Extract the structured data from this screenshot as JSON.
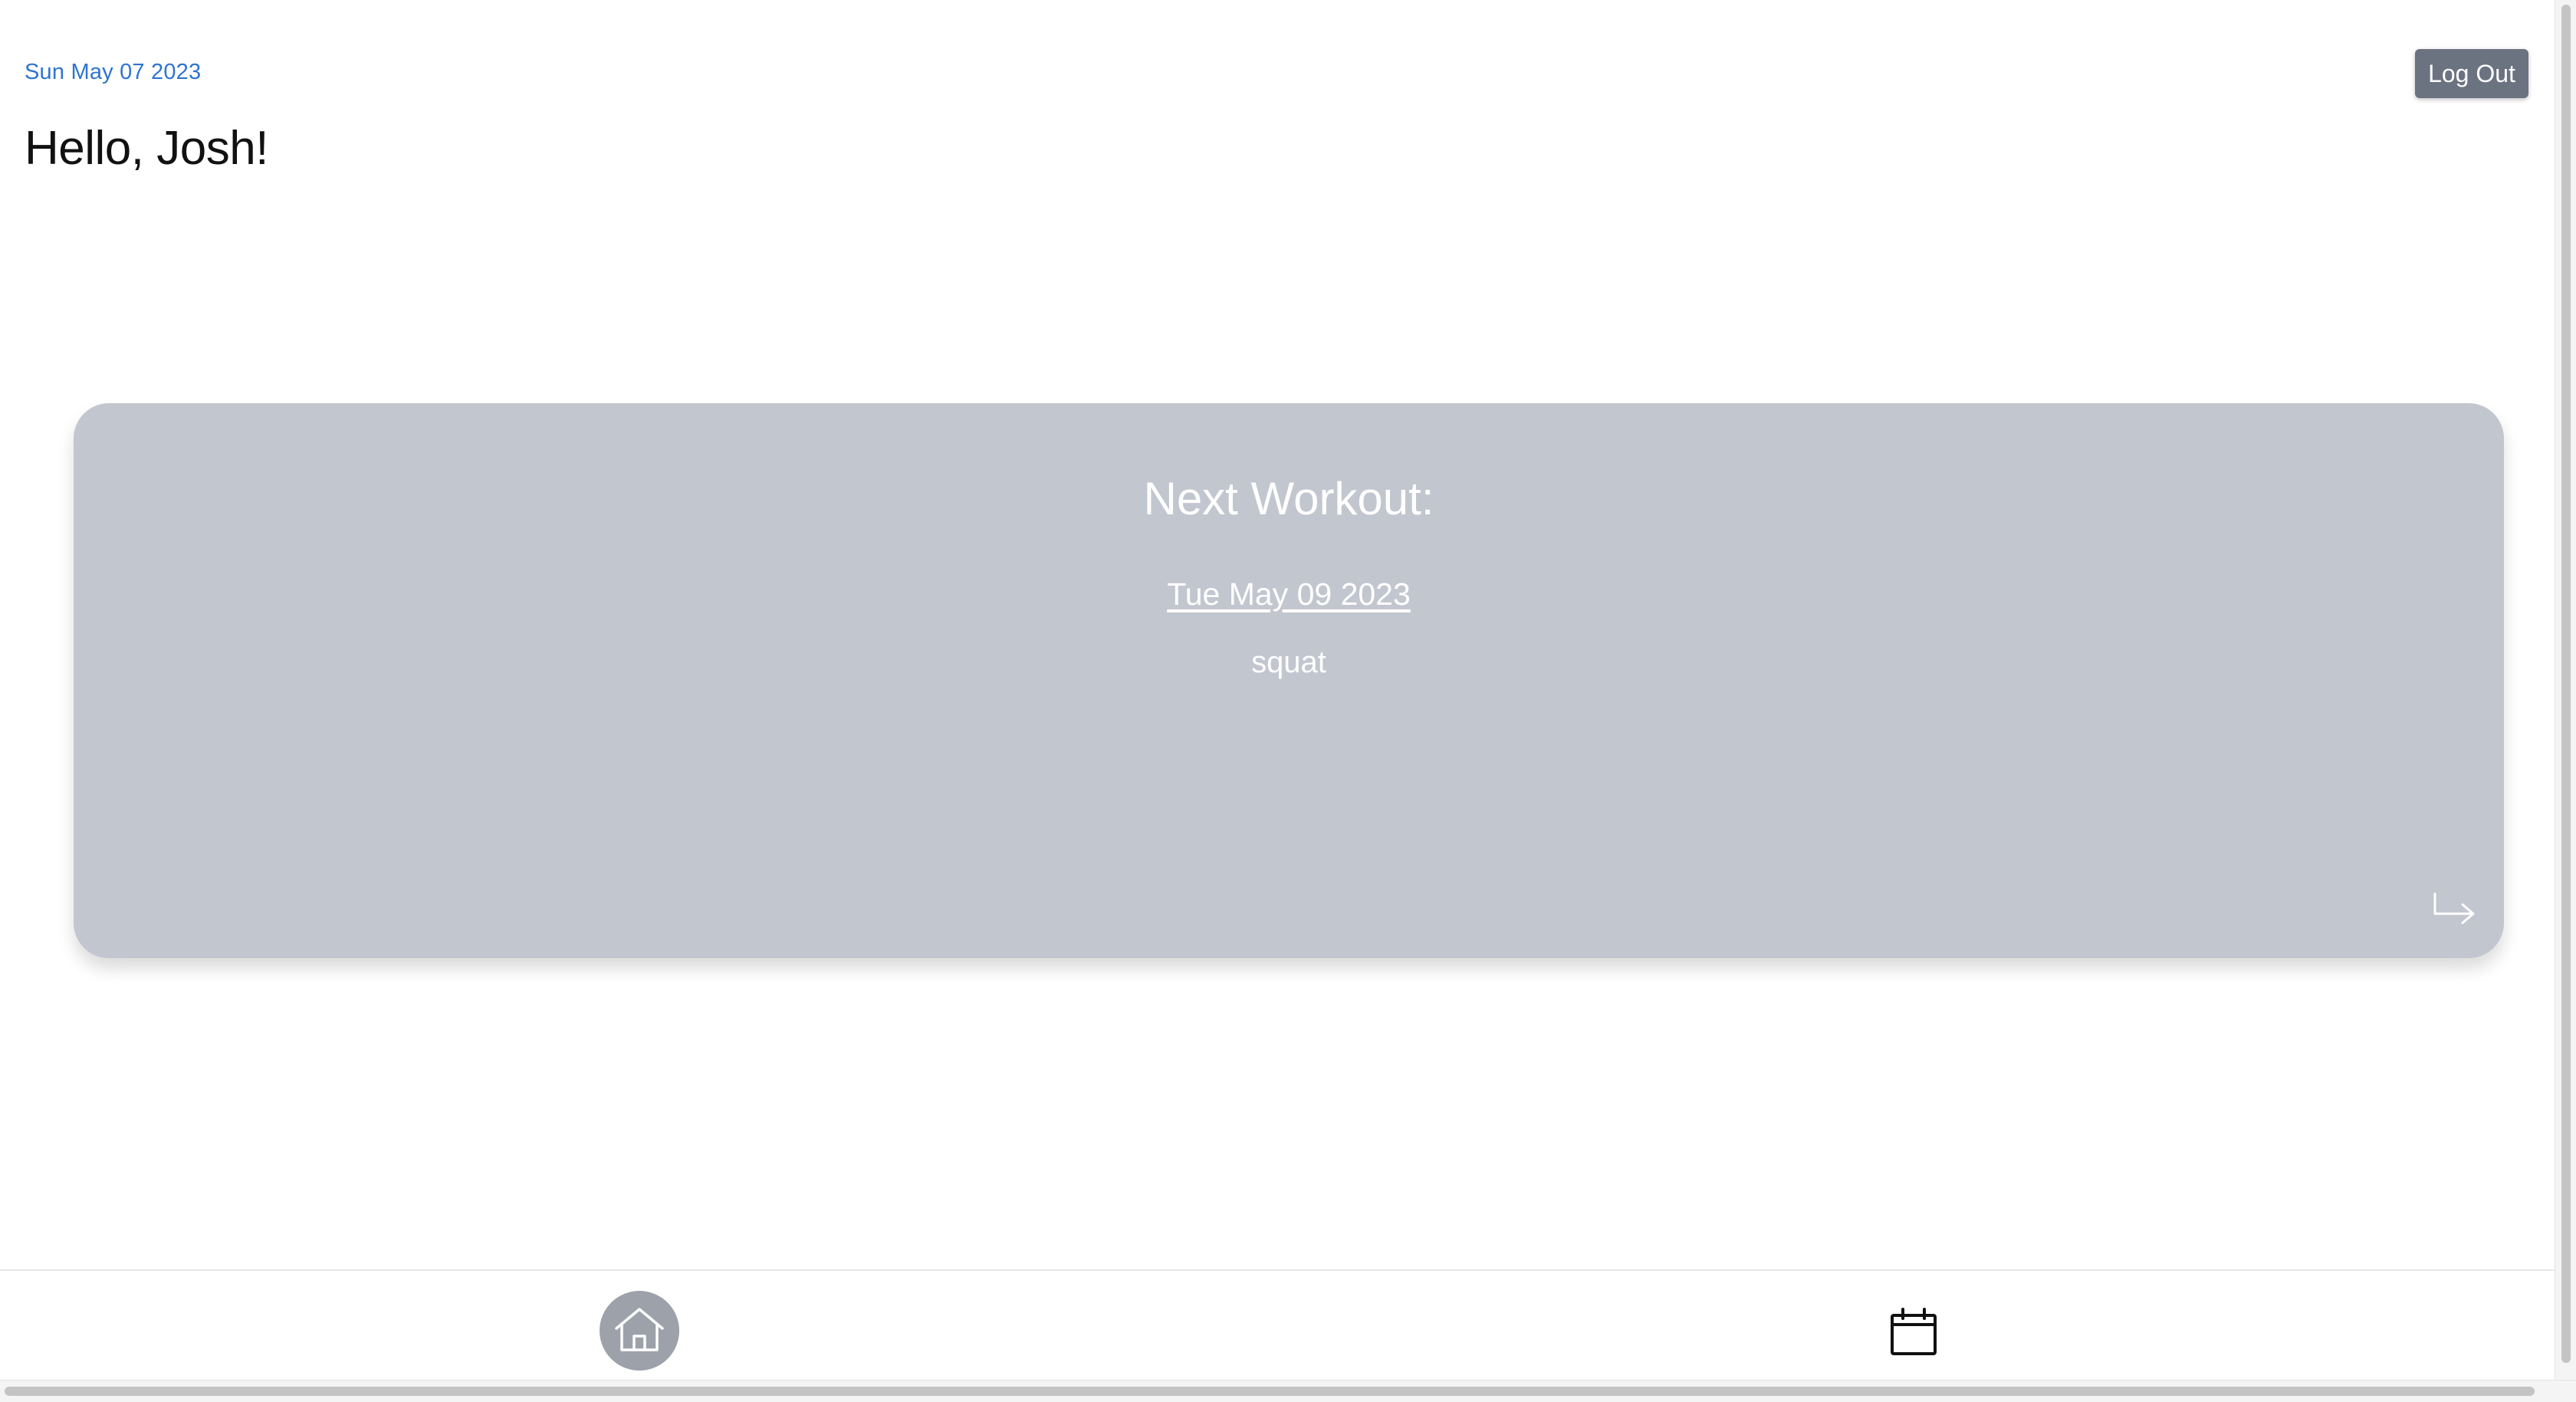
{
  "header": {
    "date": "Sun May 07 2023",
    "greeting": "Hello, Josh!",
    "logout_label": "Log Out"
  },
  "next_workout": {
    "title": "Next Workout:",
    "date": "Tue May 09 2023",
    "exercise": "squat",
    "open_icon": "corner-down-right-arrow-icon"
  },
  "bottom_nav": {
    "items": [
      {
        "icon": "home-icon",
        "active": true
      },
      {
        "icon": "calendar-icon",
        "active": false
      }
    ]
  },
  "colors": {
    "date_accent": "#2f74d0",
    "logout_bg": "#6b7280",
    "card_bg": "#c2c6cf",
    "nav_active_bg": "#9ca1aa"
  }
}
